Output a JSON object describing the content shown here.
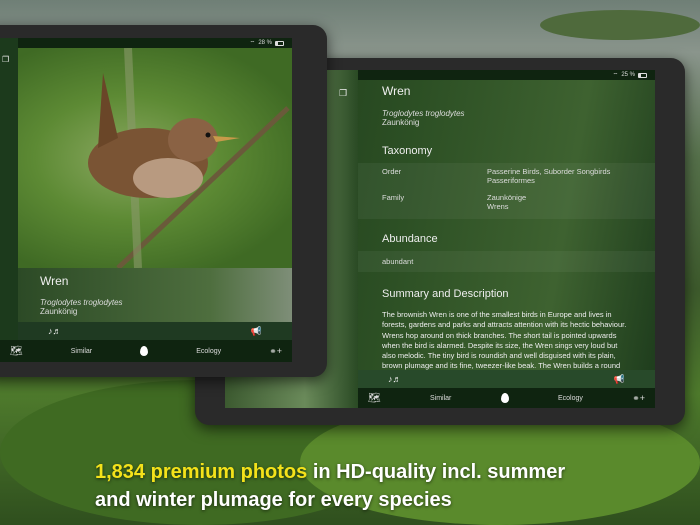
{
  "left_tablet": {
    "status": {
      "battery": "28 %"
    },
    "species": {
      "name": "Wren",
      "latin": "Troglodytes troglodytes",
      "german": "Zaunkönig"
    },
    "tabs": {
      "similar": "Similar",
      "ecology": "Ecology"
    }
  },
  "right_tablet": {
    "status": {
      "battery": "25 %"
    },
    "species": {
      "name": "Wren",
      "latin": "Troglodytes troglodytes",
      "german": "Zaunkönig"
    },
    "taxonomy": {
      "heading": "Taxonomy",
      "order_label": "Order",
      "order_value_1": "Passerine Birds, Suborder Songbirds",
      "order_value_2": "Passeriformes",
      "family_label": "Family",
      "family_value_1": "Zaunkönige",
      "family_value_2": "Wrens"
    },
    "abundance": {
      "heading": "Abundance",
      "value": "abundant"
    },
    "summary": {
      "heading": "Summary and Description",
      "text": "The brownish Wren is one of the smallest birds in Europe and lives in forests, gardens and parks and attracts attention with its hectic behaviour. Wrens hop around on thick branches. The short tail is pointed upwards when the bird is alarmed. Despite its size, the Wren sings very loud but also melodic. The tiny bird is roundish and well disguised with its plain, brown plumage and its fine, tweezer-like beak. The Wren builds a round nest of moss, dry fern leaves, thin"
    },
    "tabs": {
      "similar": "Similar",
      "ecology": "Ecology"
    }
  },
  "promo": {
    "highlight": "1,834 premium photos",
    "rest_line1": " in HD-quality incl. summer",
    "line2": "and winter plumage for every species"
  },
  "colors": {
    "highlight": "#f4e21a"
  }
}
